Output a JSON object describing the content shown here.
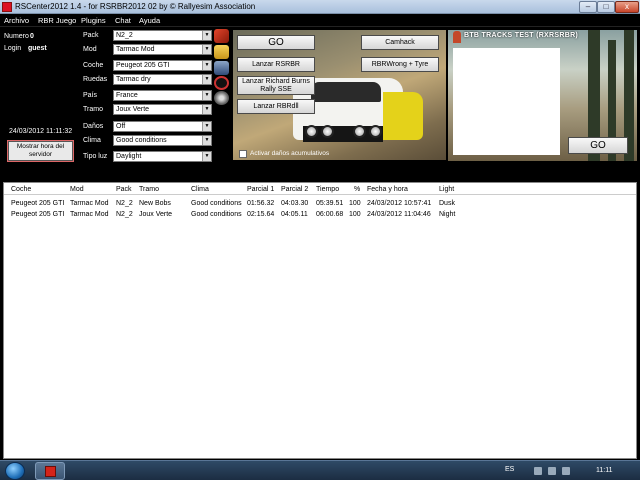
{
  "window": {
    "title": "RSCenter2012 1.4 - for RSRBR2012 02 by © Rallyesim Association",
    "minimize_glyph": "–",
    "maximize_glyph": "□",
    "close_glyph": "x"
  },
  "menu": [
    "Archivo",
    "RBR Juego",
    "Plugins",
    "Chat",
    "Ayuda"
  ],
  "user": {
    "numero_label": "Numero",
    "numero_value": "0",
    "login_label": "Login",
    "login_value": "guest",
    "datetime": "24/03/2012 11:11:32",
    "server_time_button": [
      "Mostrar hora del",
      "servidor"
    ]
  },
  "settings": {
    "pack_label": "Pack",
    "pack": "N2_2",
    "mod_label": "Mod",
    "mod": "Tarmac Mod",
    "coche_label": "Coche",
    "coche": "Peugeot 205 GTI",
    "ruedas_label": "Ruedas",
    "ruedas": "Tarmac dry",
    "pais_label": "País",
    "pais": "France",
    "tramo_label": "Tramo",
    "tramo": "Joux Verte",
    "danos_label": "Daños",
    "danos": "Off",
    "clima_label": "Clima",
    "clima": "Good conditions",
    "tipoluz_label": "Tipo luz",
    "tipoluz": "Daylight"
  },
  "center": {
    "go": "GO",
    "camhack": "Camhack",
    "lanzar_rsrbr": "Lanzar RSRBR",
    "rbrwrong": "RBRWrong + Tyre",
    "lanzar_rb_line1": "Lanzar Richard Burns",
    "lanzar_rb_line2": "Rally SSE",
    "lanzar_rbrdll": "Lanzar RBRdll",
    "activar_danos": "Activar daños acumulativos"
  },
  "right_panel": {
    "title": "BTB TRACKS TEST (RXRSRBR)",
    "go": "GO"
  },
  "table": {
    "headers": [
      "Coche",
      "Mod",
      "Pack",
      "Tramo",
      "Clima",
      "Parcial 1",
      "Parcial 2",
      "Tiempo",
      "%",
      "Fecha y hora",
      "Light"
    ],
    "rows": [
      [
        "Peugeot 205 GTI",
        "Tarmac Mod",
        "N2_2",
        "New Bobs",
        "Good conditions",
        "01:56.32",
        "04:03.30",
        "05:39.51",
        "100",
        "24/03/2012 10:57:41",
        "Dusk"
      ],
      [
        "Peugeot 205 GTI",
        "Tarmac Mod",
        "N2_2",
        "Joux Verte",
        "Good conditions",
        "02:15.64",
        "04:05.11",
        "06:00.68",
        "100",
        "24/03/2012 11:04:46",
        "Night"
      ]
    ]
  },
  "taskbar": {
    "language": "ES",
    "clock": "11:11"
  },
  "icons": {
    "cube": "cube-icon",
    "folder": "folder-icon",
    "tools": "tools-icon",
    "globe": "globe-icon",
    "disc": "disc-icon",
    "start": "windows-start-icon"
  }
}
